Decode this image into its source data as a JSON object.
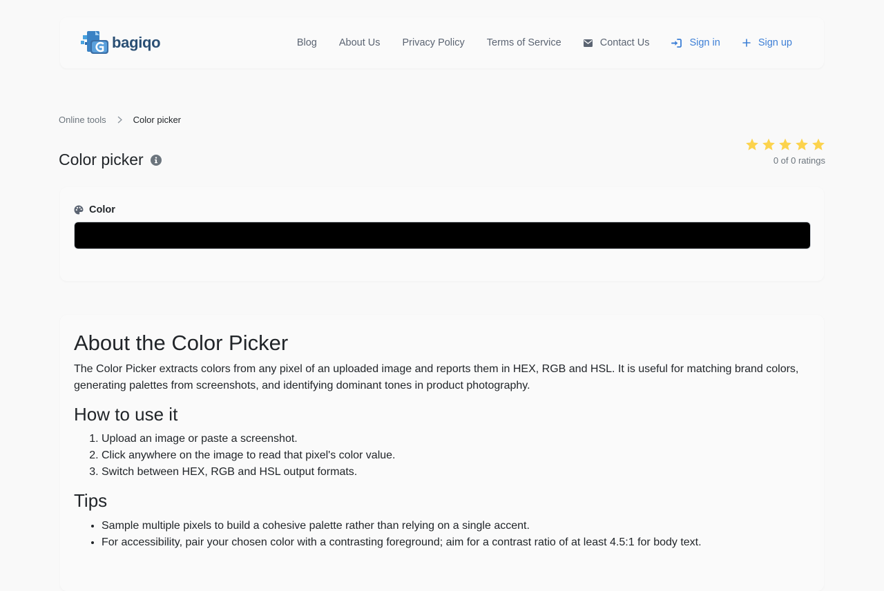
{
  "header": {
    "logo_text": "bagiqo",
    "nav": [
      {
        "label": "Blog"
      },
      {
        "label": "About Us"
      },
      {
        "label": "Privacy Policy"
      },
      {
        "label": "Terms of Service"
      },
      {
        "label": "Contact Us",
        "icon": "envelope-icon"
      },
      {
        "label": "Sign in",
        "icon": "sign-in-icon"
      },
      {
        "label": "Sign up",
        "icon": "plus-icon"
      }
    ]
  },
  "breadcrumb": {
    "parent": "Online tools",
    "current": "Color picker"
  },
  "page": {
    "title": "Color picker",
    "rating": {
      "stars": 5,
      "text": "0 of 0 ratings"
    }
  },
  "color_tool": {
    "label": "Color",
    "value": "#000000"
  },
  "about": {
    "title": "About the Color Picker",
    "description": "The Color Picker extracts colors from any pixel of an uploaded image and reports them in HEX, RGB and HSL. It is useful for matching brand colors, generating palettes from screenshots, and identifying dominant tones in product photography.",
    "how_title": "How to use it",
    "steps": [
      "Upload an image or paste a screenshot.",
      "Click anywhere on the image to read that pixel's color value.",
      "Switch between HEX, RGB and HSL output formats."
    ],
    "tips_title": "Tips",
    "tips": [
      "Sample multiple pixels to build a cohesive palette rather than relying on a single accent.",
      "For accessibility, pair your chosen color with a contrasting foreground; aim for a contrast ratio of at least 4.5:1 for body text."
    ]
  },
  "colors": {
    "accent": "#3d7fd6",
    "star": "#fcd34d",
    "nav_text": "#5b6472"
  }
}
